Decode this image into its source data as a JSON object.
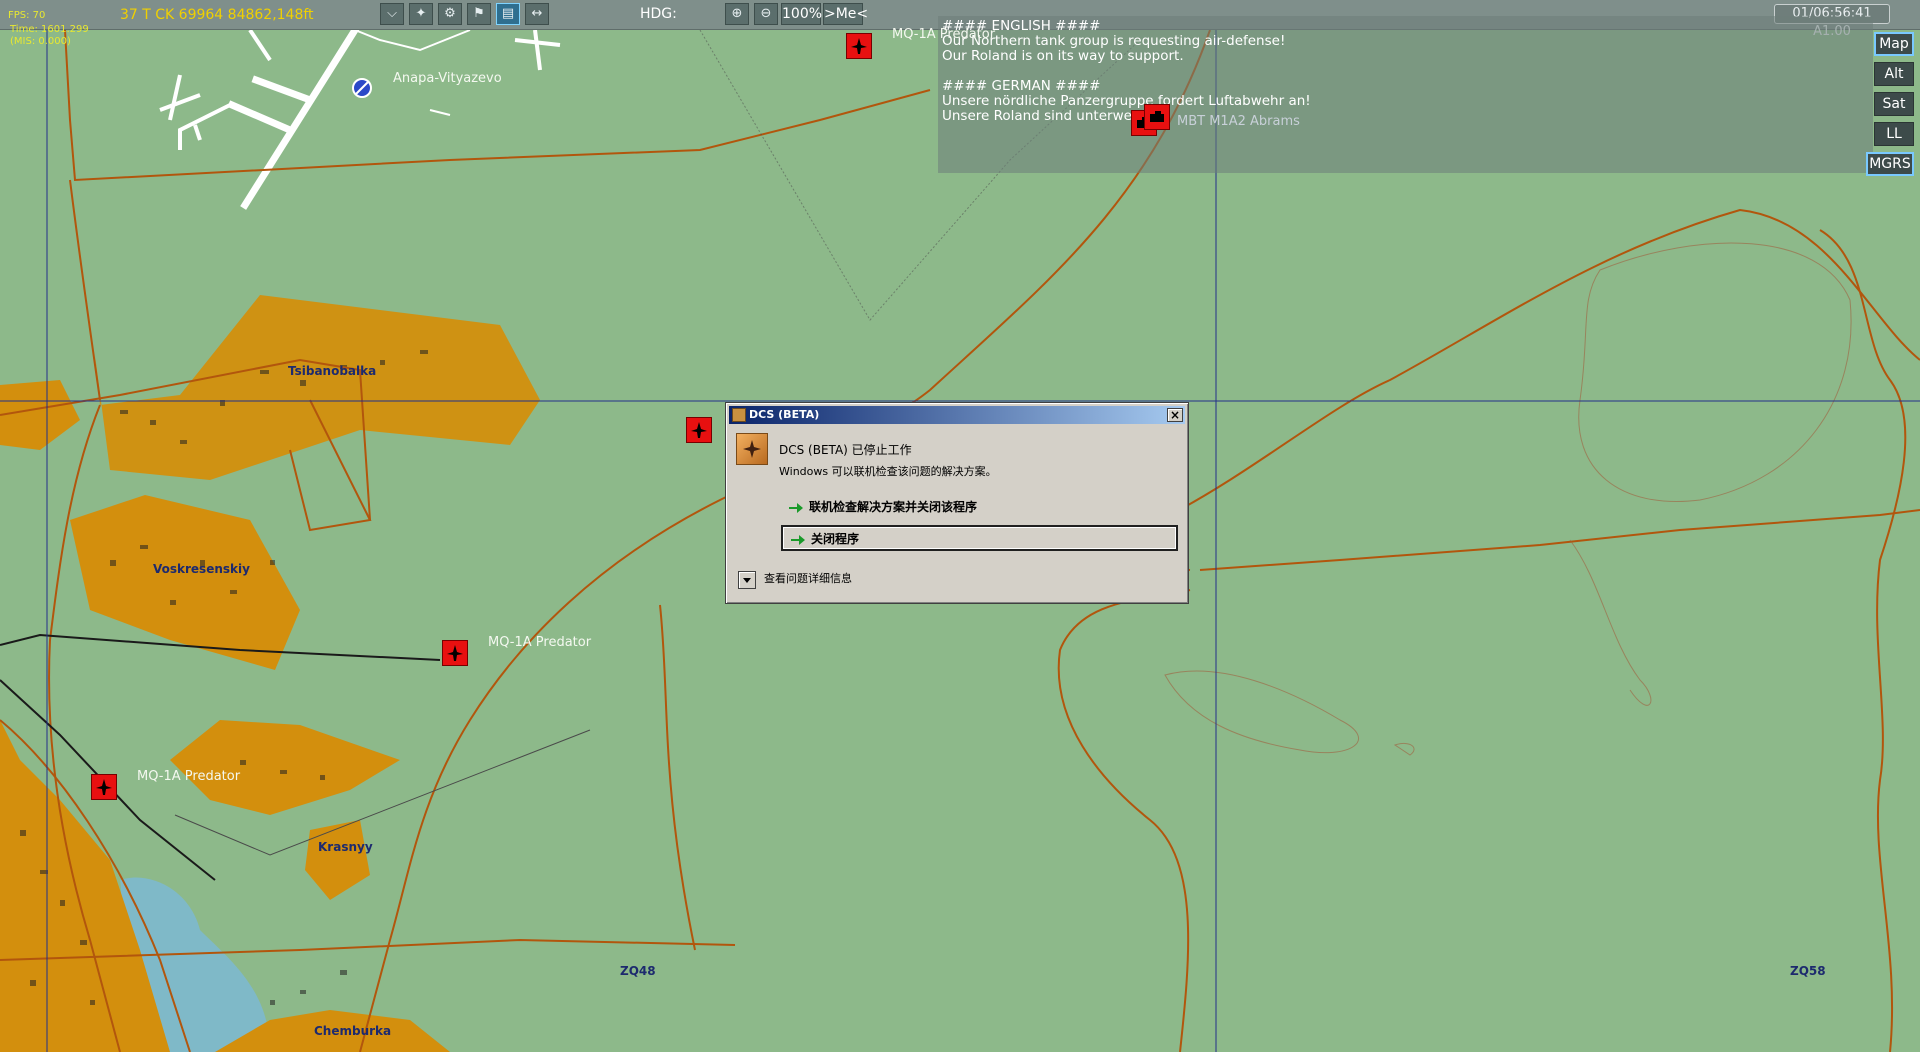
{
  "hud": {
    "fps_label": "FPS: 70",
    "time_label": "Time: 1601.299",
    "mis_label": "(MIS: 0.000)",
    "coordinate": "37 T CK 69964 84862,148ft",
    "hdg_label": "HDG:",
    "zoom": "100%",
    "me_button": ">Me<",
    "clock": "01/06:56:41 A1.00"
  },
  "message": {
    "lines": [
      "#### ENGLISH ####",
      "Our Northern tank group is requesting air-defense!",
      "Our Roland is on its way to support.",
      "",
      "#### GERMAN ####",
      "Unsere nördliche Panzergruppe fordert Luftabwehr an!",
      "Unsere Roland sind unterwegs."
    ]
  },
  "side_buttons": [
    "Map",
    "Alt",
    "Sat",
    "LL",
    "MGRS"
  ],
  "map": {
    "airfield": "Anapa-Vityazevo",
    "towns": [
      "Tsibanobalka",
      "Voskresenskiy",
      "Krasnyy",
      "Chemburka"
    ],
    "grid_labels": [
      "ZQ48",
      "ZQ58"
    ],
    "unit_labels": {
      "top": "MQ-1A Predator",
      "mid": "MQ-1A Predator",
      "left": "MQ-1A Predator",
      "tank": "MBT M1A2 Abrams"
    }
  },
  "dialog": {
    "title": "DCS (BETA)",
    "heading": "DCS (BETA) 已停止工作",
    "subtext": "Windows 可以联机检查该问题的解决方案。",
    "option1": "联机检查解决方案并关闭该程序",
    "option2": "关闭程序",
    "details": "查看问题详细信息"
  },
  "colors": {
    "terrain": "#8db98a",
    "town_fill": "#d38f0d",
    "road": "#b2560d",
    "grid_line": "#22308a",
    "unit_red": "#e81010"
  }
}
